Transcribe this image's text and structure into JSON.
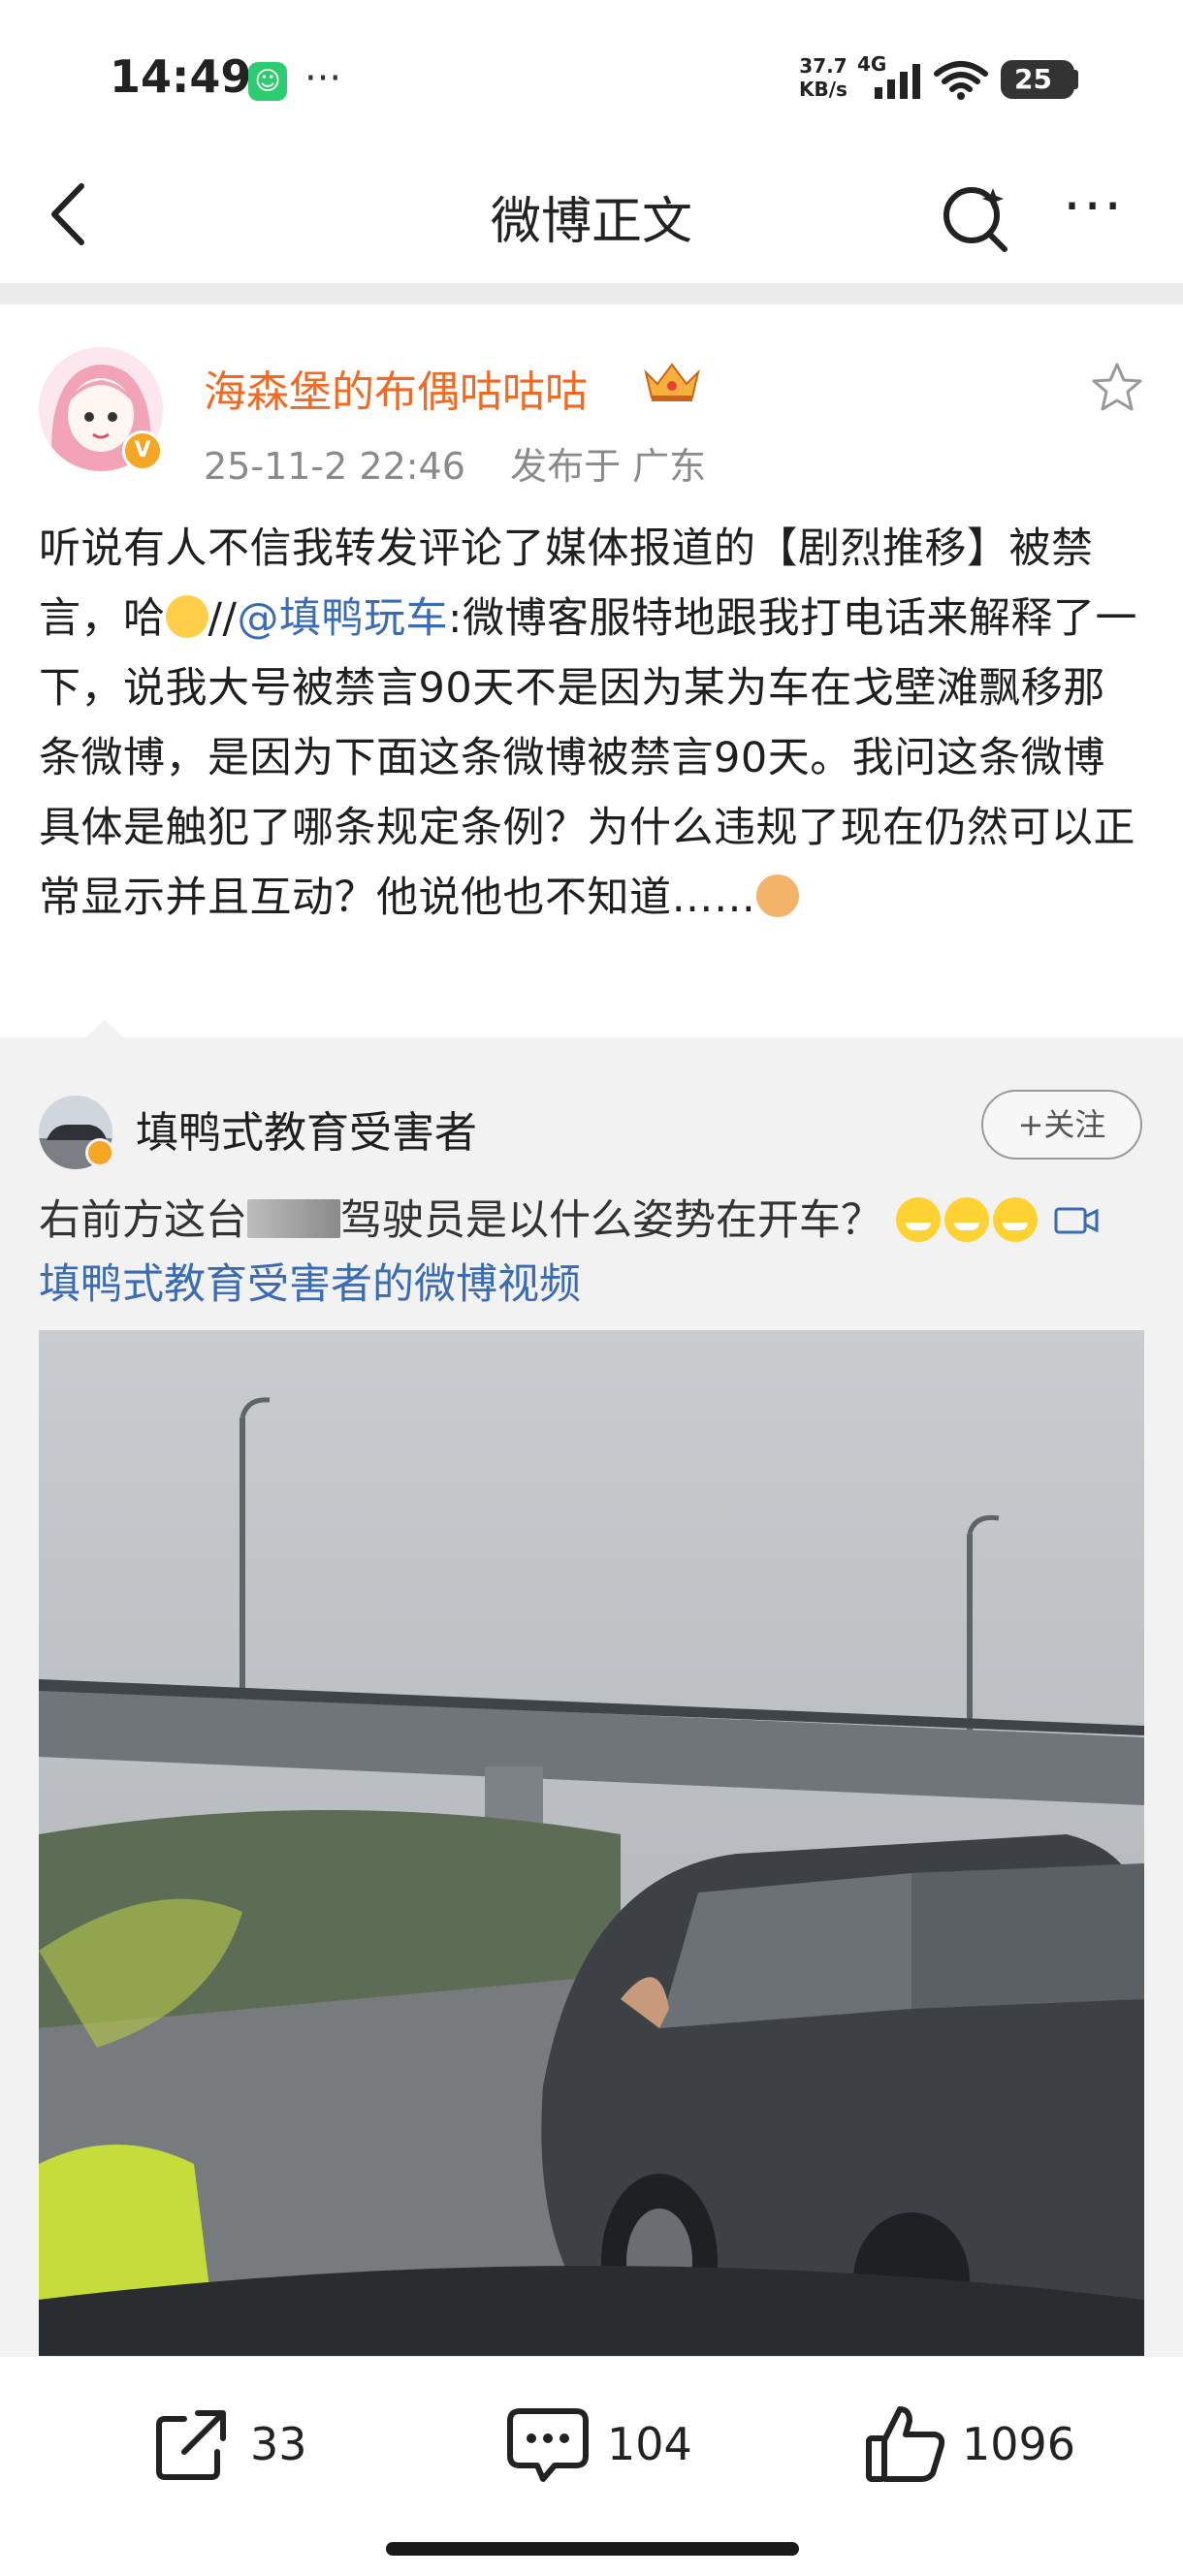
{
  "status_bar": {
    "time": "14:49",
    "network_speed": "37.7\nKB/s",
    "network_type": "4G",
    "battery": "25",
    "icons": [
      "app-notification-icon",
      "signal-icon",
      "wifi-icon",
      "battery-icon"
    ]
  },
  "nav": {
    "title": "微博正文",
    "back_icon": "chevron-left-icon",
    "search_icon": "search-icon",
    "more_icon": "more-icon",
    "more_label": "···"
  },
  "post": {
    "author": "海森堡的布偶咕咕咕",
    "author_badge_icon": "crown-icon",
    "timestamp": "25-11-2 22:46",
    "location": "发布于 广东",
    "text_part1": "听说有人不信我转发评论了媒体报道的【剧烈推移】被禁言，哈",
    "text_part2": "//",
    "mention": "@填鸭玩车",
    "text_part3": ":微博客服特地跟我打电话来解释了一下，说我大号被禁言90天不是因为某为车在戈壁滩飘移那条微博，是因为下面这条微博被禁言90天。我问这条微博具体是触犯了哪条规定条例？为什么违规了现在仍然可以正常显示并且互动？他说他也不知道……"
  },
  "repost": {
    "author": "填鸭式教育受害者",
    "follow_label": "+关注",
    "text_part1": "右前方这台",
    "text_part2": "驾驶员是以什么姿势在开车？",
    "video_link": "填鸭式教育受害者的微博视频",
    "video_icon": "video-icon"
  },
  "actions": {
    "repost_count": "33",
    "comment_count": "104",
    "like_count": "1096"
  },
  "colors": {
    "author_orange": "#f26a22",
    "link_blue": "#3a6bb5",
    "verified_badge": "#f5a623"
  }
}
